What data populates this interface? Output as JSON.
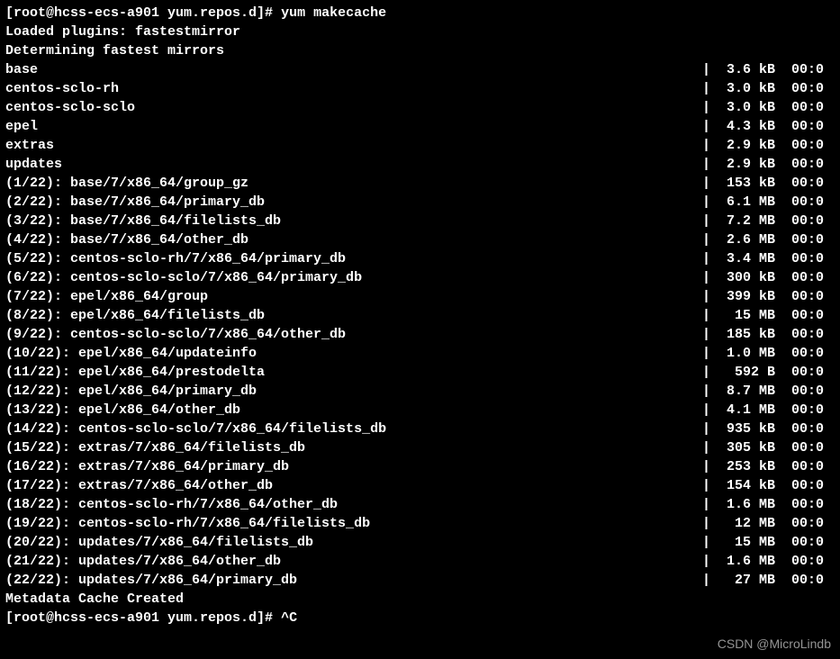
{
  "prompt1": {
    "text": "[root@hcss-ecs-a901 yum.repos.d]# ",
    "command": "yum makecache"
  },
  "messages_pre": [
    "Loaded plugins: fastestmirror",
    "Determining fastest mirrors"
  ],
  "repo_lines": [
    {
      "name": "base",
      "size": "3.6 kB",
      "time": "00:0"
    },
    {
      "name": "centos-sclo-rh",
      "size": "3.0 kB",
      "time": "00:0"
    },
    {
      "name": "centos-sclo-sclo",
      "size": "3.0 kB",
      "time": "00:0"
    },
    {
      "name": "epel",
      "size": "4.3 kB",
      "time": "00:0"
    },
    {
      "name": "extras",
      "size": "2.9 kB",
      "time": "00:0"
    },
    {
      "name": "updates",
      "size": "2.9 kB",
      "time": "00:0"
    }
  ],
  "download_lines": [
    {
      "idx": "(1/22)",
      "path": "base/7/x86_64/group_gz",
      "size": "153 kB",
      "time": "00:0"
    },
    {
      "idx": "(2/22)",
      "path": "base/7/x86_64/primary_db",
      "size": "6.1 MB",
      "time": "00:0"
    },
    {
      "idx": "(3/22)",
      "path": "base/7/x86_64/filelists_db",
      "size": "7.2 MB",
      "time": "00:0"
    },
    {
      "idx": "(4/22)",
      "path": "base/7/x86_64/other_db",
      "size": "2.6 MB",
      "time": "00:0"
    },
    {
      "idx": "(5/22)",
      "path": "centos-sclo-rh/7/x86_64/primary_db",
      "size": "3.4 MB",
      "time": "00:0"
    },
    {
      "idx": "(6/22)",
      "path": "centos-sclo-sclo/7/x86_64/primary_db",
      "size": "300 kB",
      "time": "00:0"
    },
    {
      "idx": "(7/22)",
      "path": "epel/x86_64/group",
      "size": "399 kB",
      "time": "00:0"
    },
    {
      "idx": "(8/22)",
      "path": "epel/x86_64/filelists_db",
      "size": "15 MB",
      "time": "00:0"
    },
    {
      "idx": "(9/22)",
      "path": "centos-sclo-sclo/7/x86_64/other_db",
      "size": "185 kB",
      "time": "00:0"
    },
    {
      "idx": "(10/22)",
      "path": "epel/x86_64/updateinfo",
      "size": "1.0 MB",
      "time": "00:0"
    },
    {
      "idx": "(11/22)",
      "path": "epel/x86_64/prestodelta",
      "size": "592 B",
      "time": "00:0"
    },
    {
      "idx": "(12/22)",
      "path": "epel/x86_64/primary_db",
      "size": "8.7 MB",
      "time": "00:0"
    },
    {
      "idx": "(13/22)",
      "path": "epel/x86_64/other_db",
      "size": "4.1 MB",
      "time": "00:0"
    },
    {
      "idx": "(14/22)",
      "path": "centos-sclo-sclo/7/x86_64/filelists_db",
      "size": "935 kB",
      "time": "00:0"
    },
    {
      "idx": "(15/22)",
      "path": "extras/7/x86_64/filelists_db",
      "size": "305 kB",
      "time": "00:0"
    },
    {
      "idx": "(16/22)",
      "path": "extras/7/x86_64/primary_db",
      "size": "253 kB",
      "time": "00:0"
    },
    {
      "idx": "(17/22)",
      "path": "extras/7/x86_64/other_db",
      "size": "154 kB",
      "time": "00:0"
    },
    {
      "idx": "(18/22)",
      "path": "centos-sclo-rh/7/x86_64/other_db",
      "size": "1.6 MB",
      "time": "00:0"
    },
    {
      "idx": "(19/22)",
      "path": "centos-sclo-rh/7/x86_64/filelists_db",
      "size": "12 MB",
      "time": "00:0"
    },
    {
      "idx": "(20/22)",
      "path": "updates/7/x86_64/filelists_db",
      "size": "15 MB",
      "time": "00:0"
    },
    {
      "idx": "(21/22)",
      "path": "updates/7/x86_64/other_db",
      "size": "1.6 MB",
      "time": "00:0"
    },
    {
      "idx": "(22/22)",
      "path": "updates/7/x86_64/primary_db",
      "size": "27 MB",
      "time": "00:0"
    }
  ],
  "messages_post": [
    "Metadata Cache Created"
  ],
  "prompt2": {
    "text": "[root@hcss-ecs-a901 yum.repos.d]# ",
    "command": "^C"
  },
  "watermark": "CSDN @MicroLindb",
  "size_col_width": 7
}
